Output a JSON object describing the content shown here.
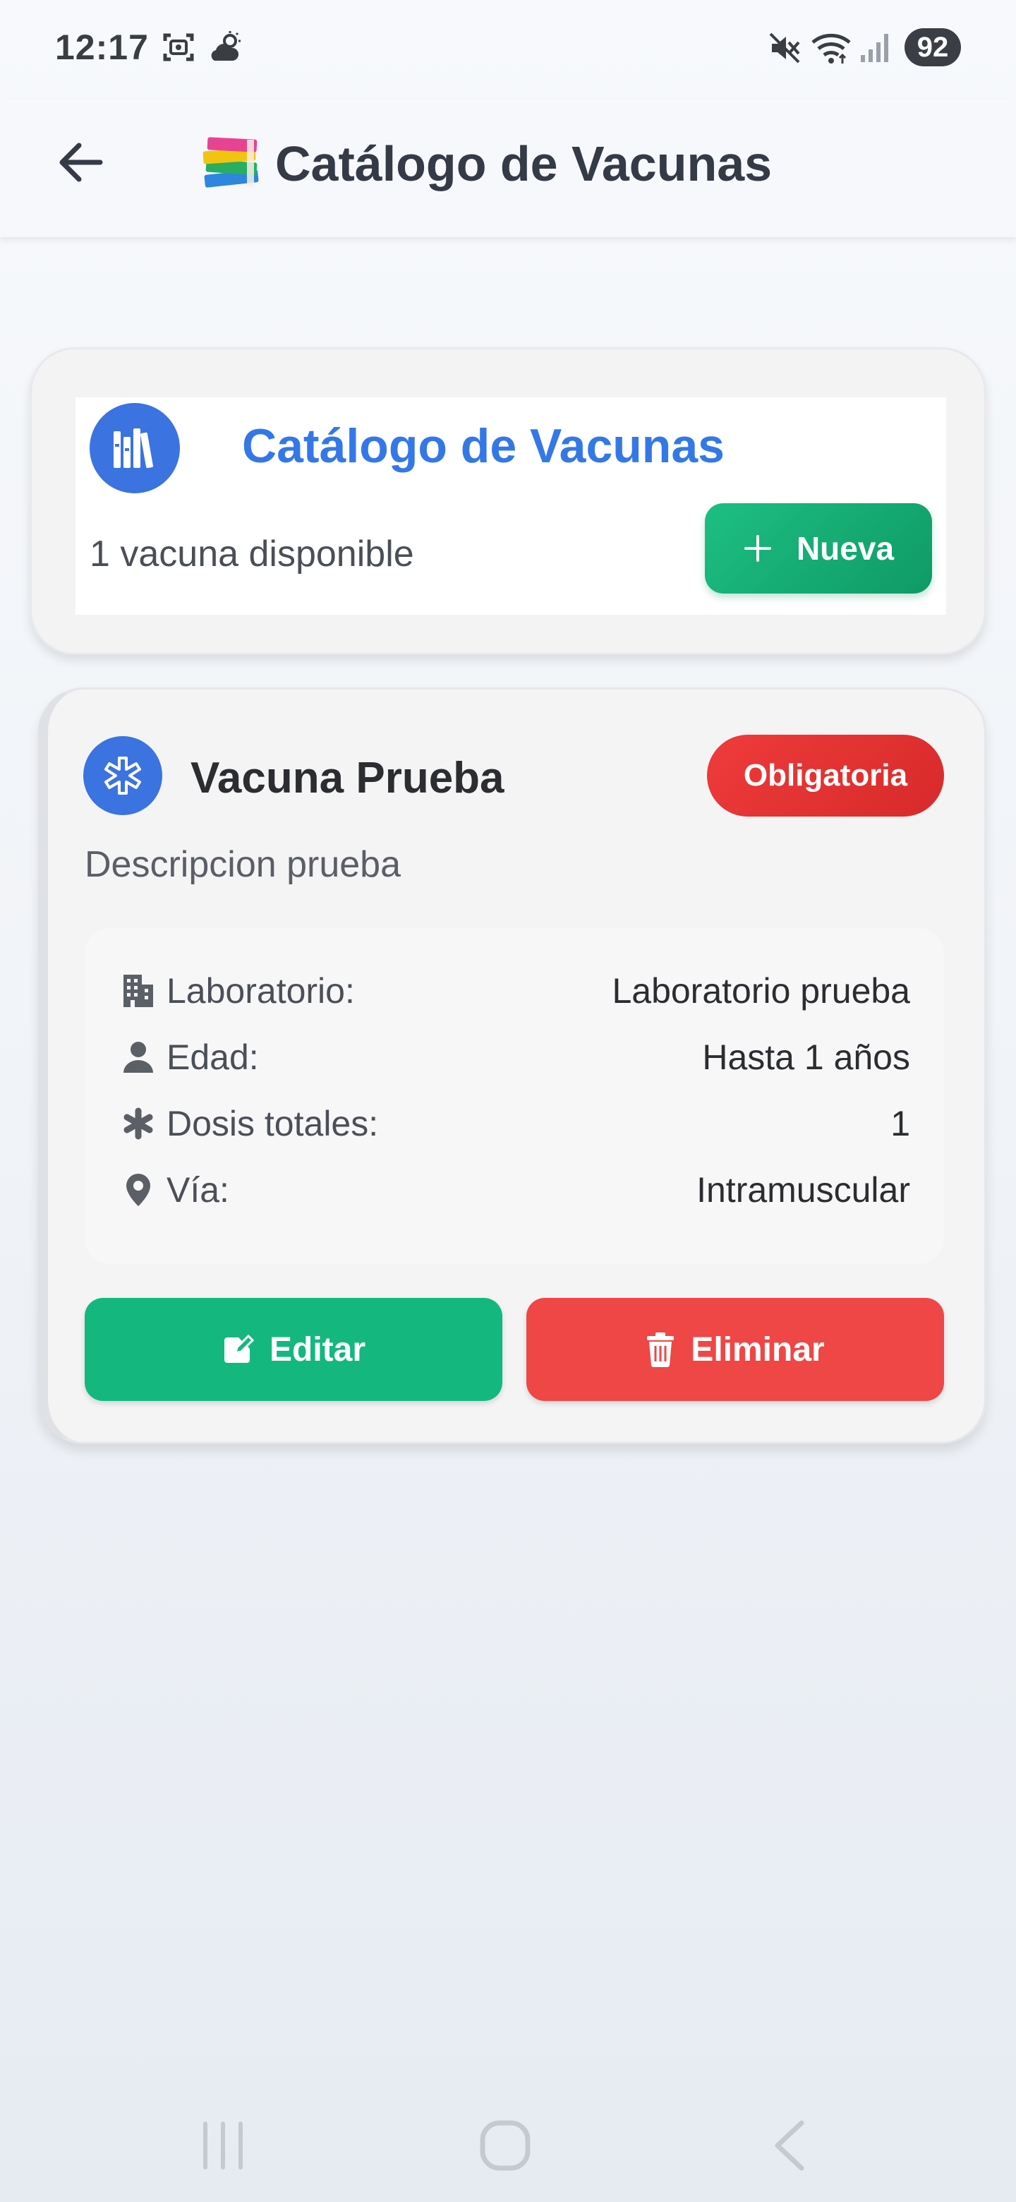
{
  "status_bar": {
    "time": "12:17",
    "battery": "92",
    "icons": [
      "screenshot-icon",
      "weather-icon",
      "mute-icon",
      "wifi-icon",
      "signal-icon"
    ]
  },
  "app_bar": {
    "title": "Catálogo de Vacunas",
    "title_icon": "books-emoji-icon",
    "back_icon": "back-arrow-icon"
  },
  "header_card": {
    "title": "Catálogo de Vacunas",
    "count_text": "1 vacuna disponible",
    "new_button_label": "Nueva",
    "accent_color": "#3478e8",
    "new_button_color": "#14b87f"
  },
  "vaccines": [
    {
      "name": "Vacuna Prueba",
      "badge": "Obligatoria",
      "description": "Descripcion prueba",
      "details": [
        {
          "icon": "building-icon",
          "label": "Laboratorio:",
          "value": "Laboratorio prueba"
        },
        {
          "icon": "user-icon",
          "label": "Edad:",
          "value": "Hasta 1 años"
        },
        {
          "icon": "asterisk-icon",
          "label": "Dosis totales:",
          "value": "1"
        },
        {
          "icon": "location-pin-icon",
          "label": "Vía:",
          "value": "Intramuscular"
        }
      ],
      "edit_label": "Editar",
      "delete_label": "Eliminar",
      "badge_color": "#e53333",
      "delete_color": "#ef4646"
    }
  ],
  "nav_bar": {
    "buttons": [
      "recent-apps-icon",
      "home-icon",
      "back-icon"
    ]
  }
}
